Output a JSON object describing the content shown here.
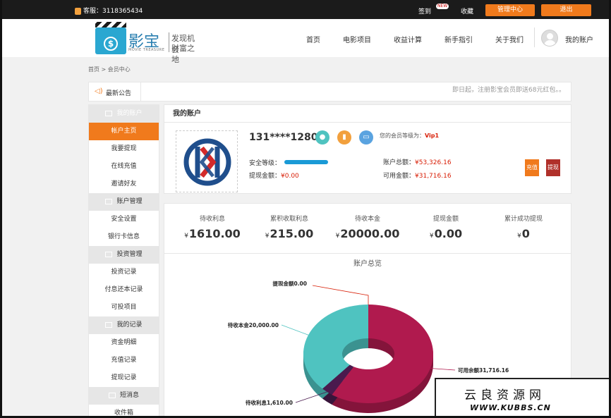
{
  "topbar": {
    "phone": "客服：3118365434",
    "signin": "签到",
    "signin_badge": "NEW",
    "favorite": "收藏",
    "manage": "管理中心",
    "logout": "退出"
  },
  "header": {
    "brand": "影宝",
    "brand_sub": "MOVIE TREASURE",
    "slogan_1": "发现机会",
    "slogan_2": "财富之地",
    "nav": [
      "首页",
      "电影项目",
      "收益计算",
      "新手指引",
      "关于我们"
    ],
    "account": "我的账户"
  },
  "breadcrumb": "首页 > 会员中心",
  "notice": {
    "label": "最新公告",
    "text": "即日起，注册影宝会员即送68元红包。。"
  },
  "sidebar": {
    "groups": [
      {
        "title": "我的账户",
        "items": [
          "帐户主页",
          "我要提现",
          "在线充值",
          "邀请好友"
        ]
      },
      {
        "title": "账户管理",
        "items": [
          "安全设置",
          "银行卡信息"
        ]
      },
      {
        "title": "投资管理",
        "items": [
          "投资记录",
          "付息还本记录",
          "可投项目"
        ]
      },
      {
        "title": "我的记录",
        "items": [
          "资金明细",
          "充值记录",
          "提现记录"
        ]
      },
      {
        "title": "短消息",
        "items": [
          "收件箱"
        ]
      }
    ]
  },
  "account": {
    "title": "我的账户",
    "username": "131****1280",
    "vip_label": "您的会员等级为：",
    "vip_level": "Vip1",
    "security_label": "安全等级：",
    "security_level": 1.0,
    "withdraw_label": "提现金额：",
    "withdraw_value": "¥0.00",
    "total_label": "账户总额：",
    "total_value": "¥53,326.16",
    "available_label": "可用金额：",
    "available_value": "¥31,716.16",
    "recharge_btn": "充值",
    "withdraw_btn": "提现"
  },
  "stats": [
    {
      "label": "待收利息",
      "currency": "¥",
      "value": "1610.00"
    },
    {
      "label": "累积收取利息",
      "currency": "¥",
      "value": "215.00"
    },
    {
      "label": "待收本金",
      "currency": "¥",
      "value": "20000.00"
    },
    {
      "label": "提现金额",
      "currency": "¥",
      "value": "0.00"
    },
    {
      "label": "累计成功提现",
      "currency": "¥",
      "value": "0"
    }
  ],
  "chart_data": {
    "type": "pie",
    "title": "账户总览",
    "slices": [
      {
        "label": "可用余额31,716.16",
        "value": 31716.16,
        "color": "#b01a4e"
      },
      {
        "label": "待收利息1,610.00",
        "value": 1610.0,
        "color": "#4a1a4e"
      },
      {
        "label": "待收本金20,000.00",
        "value": 20000.0,
        "color": "#4fc3c0"
      },
      {
        "label": "提现金额0.00",
        "value": 0.0,
        "color": "#d81e06"
      }
    ]
  },
  "watermark": {
    "cn": "云良资源网",
    "url": "WWW.KUBBS.CN"
  }
}
